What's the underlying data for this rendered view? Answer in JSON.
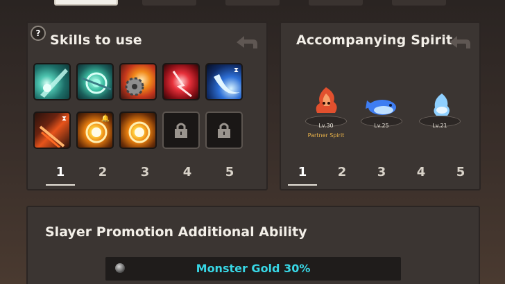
{
  "skills_panel": {
    "title": "Skills to use",
    "help_label": "?",
    "tabs": [
      "1",
      "2",
      "3",
      "4",
      "5"
    ],
    "selected_tab": "1",
    "skills": [
      {
        "icon": "teal-slash-skill-icon",
        "state": "active"
      },
      {
        "icon": "teal-vortex-skill-icon",
        "state": "active"
      },
      {
        "icon": "fire-gear-skill-icon",
        "state": "active"
      },
      {
        "icon": "red-burst-skill-icon",
        "state": "active"
      },
      {
        "icon": "blue-crescent-skill-icon",
        "state": "cooldown"
      },
      {
        "icon": "fire-sword-skill-icon",
        "state": "cooldown"
      },
      {
        "icon": "golden-sun-skill-icon",
        "state": "notified"
      },
      {
        "icon": "golden-sun-skill-icon",
        "state": "active"
      },
      {
        "icon": "lock-icon",
        "state": "locked"
      },
      {
        "icon": "lock-icon",
        "state": "locked"
      }
    ]
  },
  "spirit_panel": {
    "title": "Accompanying Spirit",
    "tabs": [
      "1",
      "2",
      "3",
      "4",
      "5"
    ],
    "selected_tab": "1",
    "spirits": [
      {
        "icon": "red-fire-spirit-icon",
        "level": "Lv.30",
        "tag": "Partner Spirit"
      },
      {
        "icon": "blue-whale-spirit-icon",
        "level": "Lv.25",
        "tag": ""
      },
      {
        "icon": "blue-wisp-spirit-icon",
        "level": "Lv.21",
        "tag": ""
      }
    ]
  },
  "promotion_panel": {
    "title": "Slayer Promotion Additional Ability",
    "ability": "Monster Gold 30%"
  },
  "colors": {
    "panel_bg": "#3b3532",
    "ability_text": "#38d7e6",
    "partner_text": "#e8b24a"
  }
}
